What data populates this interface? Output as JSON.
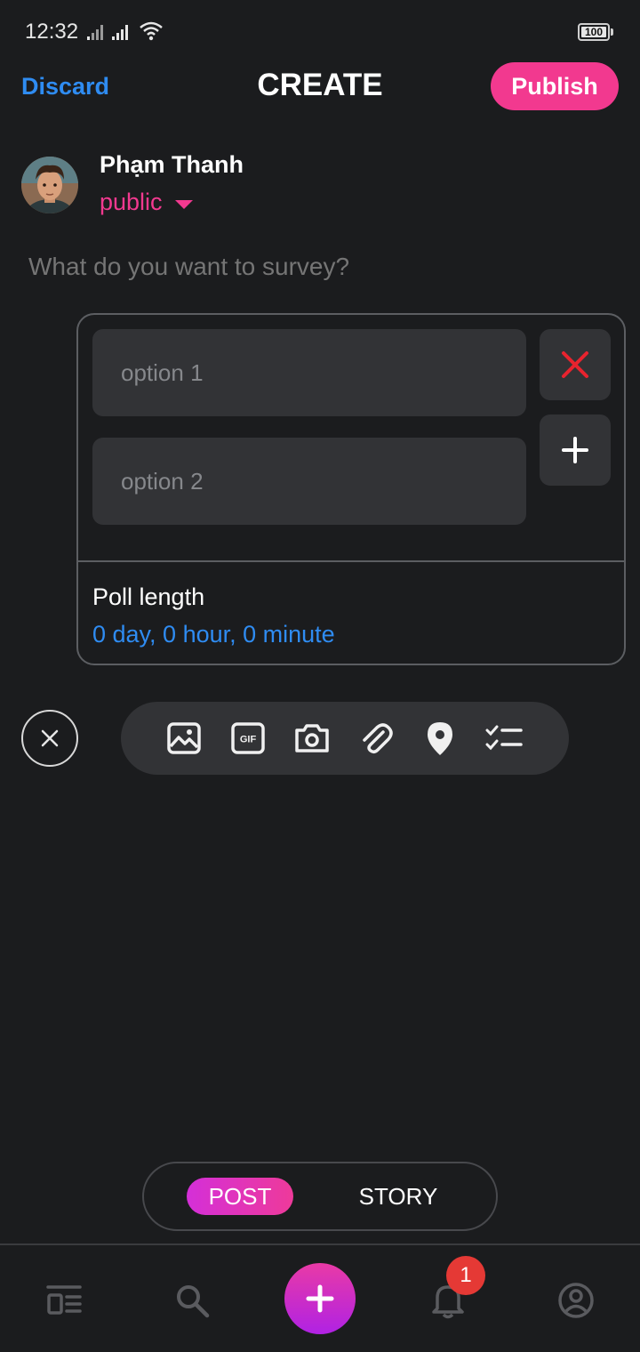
{
  "status_bar": {
    "time": "12:32",
    "battery": "100"
  },
  "header": {
    "discard_label": "Discard",
    "title": "CREATE",
    "publish_label": "Publish"
  },
  "user": {
    "name": "Phạm Thanh",
    "privacy": "public"
  },
  "composer": {
    "placeholder": "What do you want to survey?"
  },
  "poll": {
    "options": [
      {
        "placeholder": "option 1"
      },
      {
        "placeholder": "option 2"
      }
    ],
    "length_label": "Poll length",
    "length_value": "0 day, 0 hour, 0 minute"
  },
  "toolbar": {
    "icons": [
      "image-icon",
      "gif-icon",
      "camera-icon",
      "attachment-icon",
      "location-icon",
      "checklist-icon"
    ],
    "gif_text": "GIF"
  },
  "mode_toggle": {
    "post_label": "POST",
    "story_label": "STORY",
    "selected": "POST"
  },
  "bottom_nav": {
    "items": [
      "feed-icon",
      "search-icon",
      "create-icon",
      "notification-icon",
      "profile-icon"
    ],
    "notification_count": "1"
  },
  "colors": {
    "accent_blue": "#2f8cf2",
    "accent_pink": "#f2398f",
    "remove_red": "#e8232e",
    "background": "#1b1c1e"
  }
}
